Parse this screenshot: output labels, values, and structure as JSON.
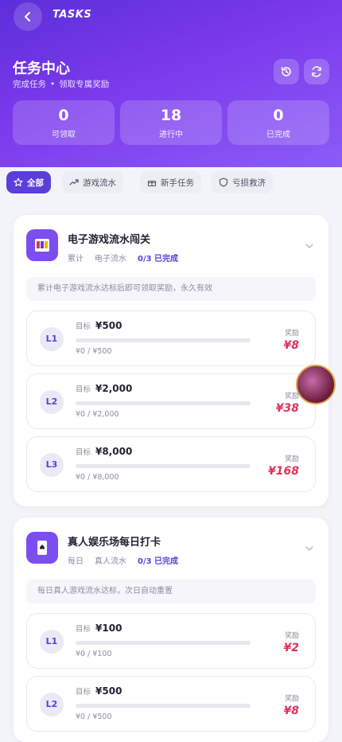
{
  "topbar": {
    "title": "TASKS"
  },
  "hero": {
    "title": "任务中心",
    "subtitle_left": "完成任务",
    "subtitle_dot": "•",
    "subtitle_right": "领取专属奖励"
  },
  "stats": [
    {
      "value": "0",
      "label": "可领取"
    },
    {
      "value": "18",
      "label": "进行中"
    },
    {
      "value": "0",
      "label": "已完成"
    }
  ],
  "filters": [
    {
      "label": "全部",
      "icon": "star-icon",
      "active": true
    },
    {
      "label": "游戏流水",
      "icon": "trend-icon",
      "active": false
    },
    {
      "label": "新手任务",
      "icon": "gift-icon",
      "active": false
    },
    {
      "label": "亏损救济",
      "icon": "shield-icon",
      "active": false
    }
  ],
  "cards": [
    {
      "title": "电子游戏流水闯关",
      "frequency": "累计",
      "type": "电子流水",
      "progress": "0/3 已完成",
      "description": "累计电子游戏流水达标后即可领取奖励，永久有效",
      "levels": [
        {
          "badge": "L1",
          "target_label": "目标",
          "target": "¥500",
          "progress": "¥0 / ¥500",
          "fraction": 0,
          "reward_label": "奖励",
          "reward": "¥8"
        },
        {
          "badge": "L2",
          "target_label": "目标",
          "target": "¥2,000",
          "progress": "¥0 / ¥2,000",
          "fraction": 0,
          "reward_label": "奖励",
          "reward": "¥38"
        },
        {
          "badge": "L3",
          "target_label": "目标",
          "target": "¥8,000",
          "progress": "¥0 / ¥8,000",
          "fraction": 0,
          "reward_label": "奖励",
          "reward": "¥168"
        }
      ]
    },
    {
      "title": "真人娱乐场每日打卡",
      "frequency": "每日",
      "type": "真人流水",
      "progress": "0/3 已完成",
      "description": "每日真人游戏流水达标，次日自动重置",
      "levels": [
        {
          "badge": "L1",
          "target_label": "目标",
          "target": "¥100",
          "progress": "¥0 / ¥100",
          "fraction": 0,
          "reward_label": "奖励",
          "reward": "¥2"
        },
        {
          "badge": "L2",
          "target_label": "目标",
          "target": "¥500",
          "progress": "¥0 / ¥500",
          "fraction": 0,
          "reward_label": "奖励",
          "reward": "¥8"
        }
      ]
    }
  ],
  "colors": {
    "accent": "#5b3fd9",
    "reward": "#e0315b",
    "header_start": "#5b2ed8",
    "header_end": "#8b5cf6"
  },
  "icons": {
    "back": "chevron-left-icon",
    "history": "history-icon",
    "refresh": "refresh-icon",
    "card1": "slot-machine-icon",
    "card2": "playing-card-icon"
  }
}
